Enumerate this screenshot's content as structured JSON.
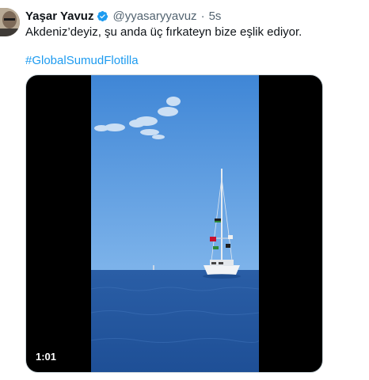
{
  "tweet": {
    "author_name": "Yaşar Yavuz",
    "handle": "@yyasaryyavuz",
    "separator": "·",
    "time": "5s",
    "text": "Akdeniz’deyiz, şu anda üç fırkateyn bize eşlik ediyor.",
    "hashtag": "#GlobalSumudFlotilla"
  },
  "media": {
    "duration": "1:01",
    "content": "video"
  },
  "colors": {
    "link": "#1d9bf0",
    "secondary_text": "#536471",
    "sea": "#2f5fa8",
    "sky": "#5b9be0"
  },
  "icons": [
    "verified-badge-icon"
  ]
}
